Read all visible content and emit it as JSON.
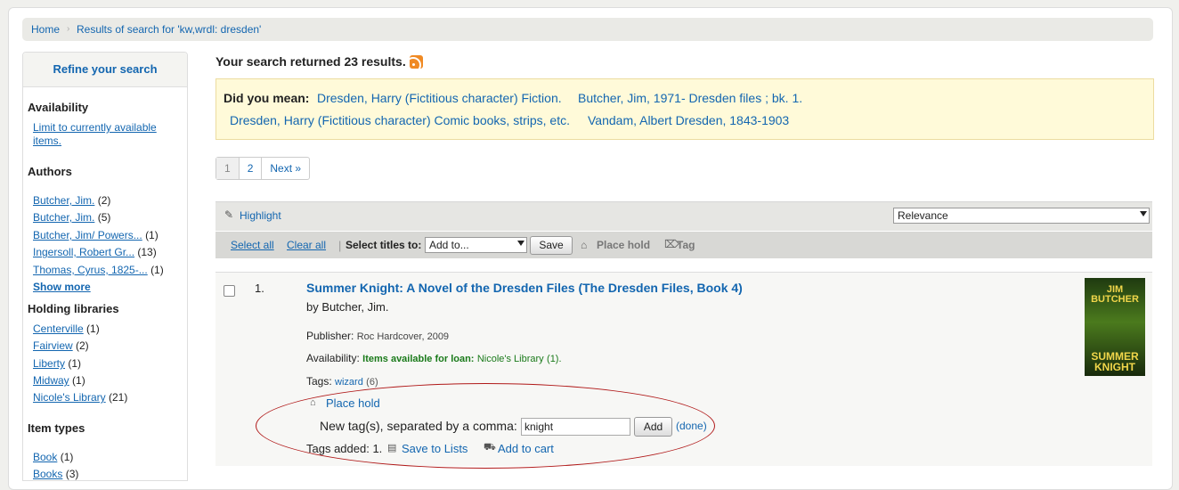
{
  "breadcrumb": {
    "home": "Home",
    "sep": "›",
    "current": "Results of search for 'kw,wrdl: dresden'"
  },
  "sidebar": {
    "title": "Refine your search",
    "availability": {
      "heading": "Availability",
      "link": [
        "Limit to currently available",
        "items."
      ]
    },
    "authors": {
      "heading": "Authors",
      "items": [
        {
          "label": "Butcher, Jim.",
          "count": "(2)"
        },
        {
          "label": "Butcher, Jim.",
          "count": "(5)"
        },
        {
          "label": "Butcher, Jim/ Powers...",
          "count": "(1)"
        },
        {
          "label": "Ingersoll, Robert Gr...",
          "count": "(13)"
        },
        {
          "label": "Thomas, Cyrus, 1825-...",
          "count": "(1)"
        }
      ],
      "show_more": "Show more"
    },
    "libraries": {
      "heading": "Holding libraries",
      "items": [
        {
          "label": "Centerville",
          "count": "(1)"
        },
        {
          "label": "Fairview",
          "count": "(2)"
        },
        {
          "label": "Liberty",
          "count": "(1)"
        },
        {
          "label": "Midway",
          "count": "(1)"
        },
        {
          "label": "Nicole's Library",
          "count": "(21)"
        }
      ]
    },
    "itemtypes": {
      "heading": "Item types",
      "items": [
        {
          "label": "Book",
          "count": "(1)"
        },
        {
          "label": "Books",
          "count": "(3)"
        }
      ]
    }
  },
  "results": {
    "summary": "Your search returned 23 results."
  },
  "didyoumean": {
    "label": "Did you mean:",
    "suggestions": [
      "Dresden, Harry (Fictitious character) Fiction.",
      "Butcher, Jim, 1971- Dresden files ; bk. 1.",
      "Dresden, Harry (Fictitious character) Comic books, strips, etc.",
      "Vandam, Albert Dresden, 1843-1903"
    ]
  },
  "pager": {
    "pages": [
      "1",
      "2"
    ],
    "next": "Next »"
  },
  "toolbar": {
    "highlight": "Highlight",
    "sort": "Relevance",
    "select_all": "Select all",
    "clear_all": "Clear all",
    "select_titles": "Select titles to:",
    "add_to": "Add to...",
    "save": "Save",
    "place_hold": "Place hold",
    "tag": "Tag"
  },
  "record": {
    "number": "1.",
    "title": "Summer Knight: A Novel of the Dresden Files (The Dresden Files, Book 4)",
    "author": "by Butcher, Jim.",
    "publisher_label": "Publisher:",
    "publisher": "Roc Hardcover, 2009",
    "availability_label": "Availability:",
    "availability_status": "Items available for loan:",
    "availability_lib": "Nicole's Library",
    "availability_count": "(1).",
    "tags_label": "Tags:",
    "tag": "wizard",
    "tag_count": "(6)",
    "place_hold": "Place hold",
    "new_tags_label": "New tag(s), separated by a comma:",
    "new_tags_value": "knight",
    "add": "Add",
    "done": "(done)",
    "tags_added": "Tags added: 1.",
    "save_to_lists": "Save to Lists",
    "add_to_cart": "Add to cart",
    "cover_top": [
      "JIM",
      "BUTCHER"
    ],
    "cover_bottom": [
      "SUMMER",
      "KNIGHT"
    ]
  }
}
